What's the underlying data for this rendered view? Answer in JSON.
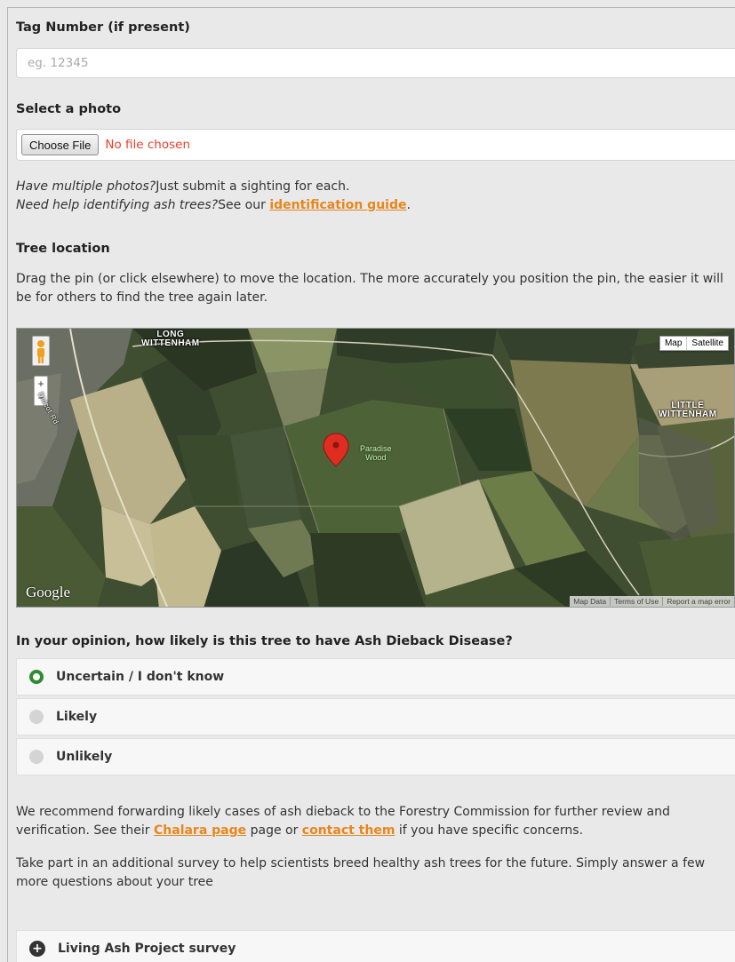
{
  "tag": {
    "label": "Tag Number (if present)",
    "placeholder": "eg. 12345"
  },
  "photo": {
    "label": "Select a photo",
    "button": "Choose File",
    "status": "No file chosen"
  },
  "help": {
    "line1_italic": "Have multiple photos?",
    "line1_rest": "Just submit a sighting for each.",
    "line2_italic": "Need help identifying ash trees?",
    "line2_rest": "See our ",
    "line2_link": "identification guide",
    "line2_end": "."
  },
  "location": {
    "label": "Tree location",
    "instructions": "Drag the pin (or click elsewhere) to move the location. The more accurately you position the pin, the easier it will be for others to find the tree again later."
  },
  "map": {
    "type_map": "Map",
    "type_satellite": "Satellite",
    "zoom_in": "+",
    "zoom_out": "−",
    "place_long_1": "LONG",
    "place_long_2": "WITTENHAM",
    "place_little_1": "LITTLE",
    "place_little_2": "WITTENHAM",
    "wood_1": "Paradise",
    "wood_2": "Wood",
    "road": "Didcot Rd",
    "google": "Google",
    "attrib_data": "Map Data",
    "attrib_terms": "Terms of Use",
    "attrib_report": "Report a map error"
  },
  "disease": {
    "question": "In your opinion, how likely is this tree to have Ash Dieback Disease?",
    "options": [
      {
        "label": "Uncertain / I don't know",
        "selected": true
      },
      {
        "label": "Likely",
        "selected": false
      },
      {
        "label": "Unlikely",
        "selected": false
      }
    ]
  },
  "recommend": {
    "text1": "We recommend forwarding likely cases of ash dieback to the Forestry Commission for further review and verification. See their ",
    "link1": "Chalara page",
    "text2": " page or ",
    "link2": "contact them",
    "text3": " if you have specific concerns."
  },
  "survey": {
    "intro": "Take part in an additional survey to help scientists breed healthy ash trees for the future. Simply answer a few more questions about your tree",
    "button": "Living Ash Project survey"
  },
  "colors": {
    "link": "#e8861c",
    "radio_selected": "#2f8b2f",
    "file_status": "#e8402a"
  }
}
